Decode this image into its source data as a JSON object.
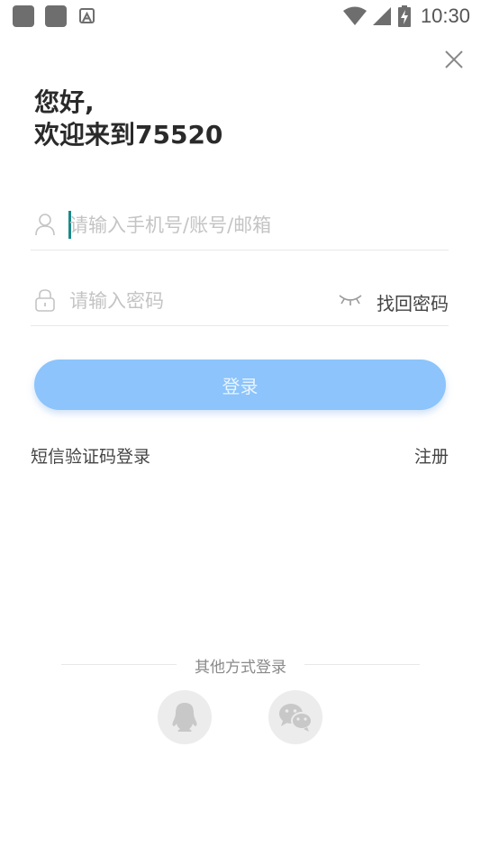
{
  "status_bar": {
    "time": "10:30",
    "icons": [
      "app-square-icon",
      "app-square-icon",
      "a-letter-icon",
      "wifi-icon",
      "signal-icon",
      "battery-charging-icon"
    ]
  },
  "greeting": {
    "line1": "您好,",
    "line2": "欢迎来到75520"
  },
  "account_field": {
    "placeholder": "请输入手机号/账号/邮箱",
    "value": "",
    "icon": "user-icon"
  },
  "password_field": {
    "placeholder": "请输入密码",
    "value": "",
    "icon": "lock-icon",
    "toggle_icon": "eye-closed-icon",
    "forgot_label": "找回密码"
  },
  "login_button": {
    "label": "登录",
    "color": "#8cc4fb"
  },
  "links": {
    "sms_login": "短信验证码登录",
    "register": "注册"
  },
  "other_login": {
    "label": "其他方式登录",
    "options": [
      "qq-icon",
      "wechat-icon"
    ]
  }
}
